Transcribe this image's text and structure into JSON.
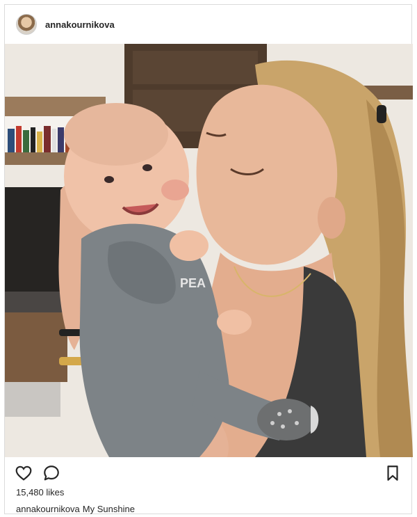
{
  "post": {
    "username": "annakournikova",
    "likes": "15,480 likes",
    "caption_user": "annakournikova",
    "caption_text": "My Sunshine",
    "onesie_text": "PEA"
  },
  "icons": {
    "like": "heart-icon",
    "comment": "comment-bubble-icon",
    "save": "bookmark-icon"
  }
}
